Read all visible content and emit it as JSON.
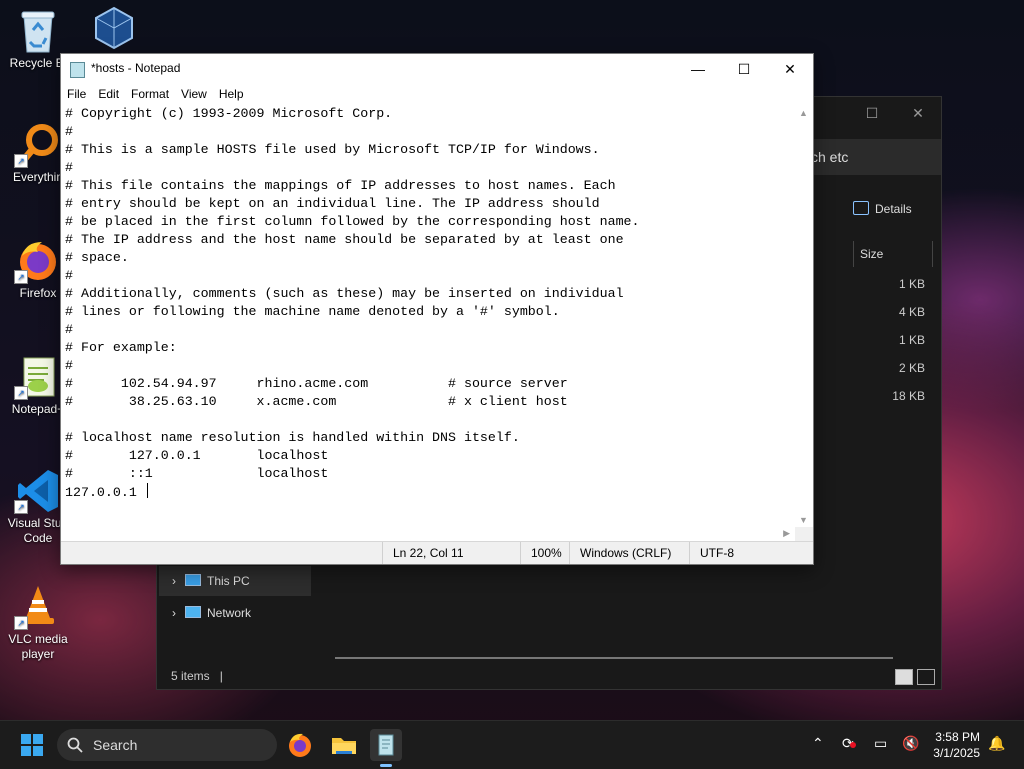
{
  "desktop": {
    "icons": [
      {
        "label": "Recycle Bi",
        "icon": "recycle-bin-icon"
      },
      {
        "label": "Everythin",
        "icon": "everything-search-icon"
      },
      {
        "label": "Firefox",
        "icon": "firefox-icon"
      },
      {
        "label": "Notepad+",
        "icon": "notepad-plus-plus-icon"
      },
      {
        "label": "Visual Stud Code",
        "icon": "vscode-icon"
      },
      {
        "label": "VLC media player",
        "icon": "vlc-icon"
      },
      {
        "label": "",
        "icon": "virtualbox-icon"
      }
    ]
  },
  "explorer": {
    "address_text": "ch etc",
    "details_label": "Details",
    "column_size": "Size",
    "sizes": [
      "1 KB",
      "4 KB",
      "1 KB",
      "2 KB",
      "18 KB"
    ],
    "nav": [
      {
        "label": "This PC",
        "icon": "monitor-icon"
      },
      {
        "label": "Network",
        "icon": "network-icon"
      }
    ],
    "status": "5 items"
  },
  "notepad": {
    "title": "*hosts - Notepad",
    "menu": [
      "File",
      "Edit",
      "Format",
      "View",
      "Help"
    ],
    "lines": [
      "# Copyright (c) 1993-2009 Microsoft Corp.",
      "#",
      "# This is a sample HOSTS file used by Microsoft TCP/IP for Windows.",
      "#",
      "# This file contains the mappings of IP addresses to host names. Each",
      "# entry should be kept on an individual line. The IP address should",
      "# be placed in the first column followed by the corresponding host name.",
      "# The IP address and the host name should be separated by at least one",
      "# space.",
      "#",
      "# Additionally, comments (such as these) may be inserted on individual",
      "# lines or following the machine name denoted by a '#' symbol.",
      "#",
      "# For example:",
      "#",
      "#      102.54.94.97     rhino.acme.com          # source server",
      "#       38.25.63.10     x.acme.com              # x client host",
      "",
      "# localhost name resolution is handled within DNS itself.",
      "#       127.0.0.1       localhost",
      "#       ::1             localhost",
      "127.0.0.1 "
    ],
    "status": {
      "position": "Ln 22, Col 11",
      "zoom": "100%",
      "line_ending": "Windows (CRLF)",
      "encoding": "UTF-8"
    }
  },
  "taskbar": {
    "search_label": "Search",
    "time": "3:58 PM",
    "date": "3/1/2025"
  },
  "colors": {
    "taskbar": "#1c1c1c",
    "explorer_bg": "#191919",
    "accent": "#0078d4"
  }
}
